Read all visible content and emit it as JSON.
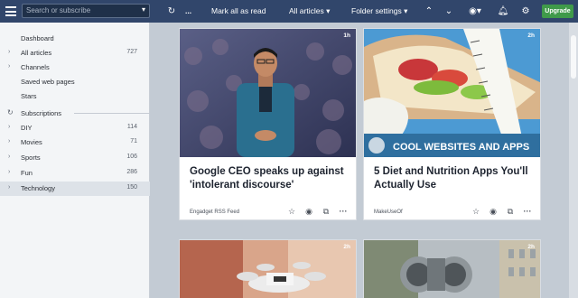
{
  "toolbar": {
    "search_placeholder": "Search or subscribe",
    "more": "...",
    "mark_all_as_read": "Mark all as read",
    "all_articles": "All articles",
    "folder_settings": "Folder settings",
    "upgrade": "Upgrade"
  },
  "sidebar": {
    "items": [
      {
        "label": "Dashboard",
        "count": ""
      },
      {
        "label": "All articles",
        "count": "727"
      },
      {
        "label": "Channels",
        "count": ""
      },
      {
        "label": "Saved web pages",
        "count": ""
      },
      {
        "label": "Stars",
        "count": ""
      }
    ],
    "subscriptions_label": "Subscriptions",
    "folders": [
      {
        "label": "DIY",
        "count": "114"
      },
      {
        "label": "Movies",
        "count": "71"
      },
      {
        "label": "Sports",
        "count": "106"
      },
      {
        "label": "Fun",
        "count": "286"
      },
      {
        "label": "Technology",
        "count": "150"
      }
    ]
  },
  "cards": [
    {
      "age": "1h",
      "title": "Google CEO speaks up against 'intolerant discourse'",
      "source": "Engadget RSS Feed"
    },
    {
      "age": "2h",
      "title": "5 Diet and Nutrition Apps You'll Actually Use",
      "source": "MakeUseOf",
      "image_text": "COOL WEBSITES AND APPS"
    },
    {
      "age": "2h"
    },
    {
      "age": "2h"
    }
  ],
  "colors": {
    "topbar": "#31466b",
    "upgrade": "#3f9a4a",
    "sidebar_selected": "#dde2e8",
    "content_bg": "#c3cbd4"
  }
}
